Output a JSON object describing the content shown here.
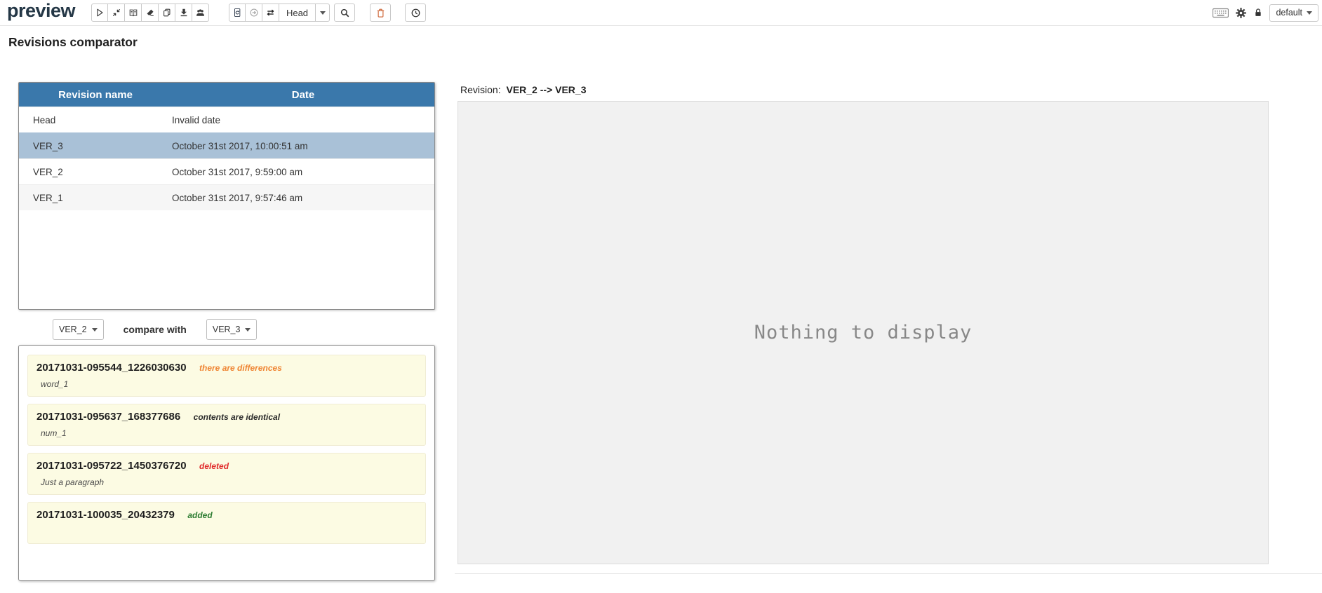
{
  "topbar": {
    "logo": "preview",
    "head_selector_label": "Head",
    "profile_label": "default",
    "icons": {
      "group1": [
        "play-icon",
        "collapse-icon",
        "book-icon",
        "eraser-icon",
        "copy-icon",
        "download-icon",
        "users-icon"
      ],
      "group2": [
        "page-refresh-icon",
        "circle-arrow-icon",
        "swap-icon"
      ],
      "single": [
        "search-icon",
        "trash-icon",
        "clock-icon"
      ],
      "right": [
        "keyboard-icon",
        "gear-icon",
        "lock-icon"
      ]
    }
  },
  "page": {
    "title": "Revisions comparator"
  },
  "revisions_table": {
    "columns": [
      "Revision name",
      "Date"
    ],
    "rows": [
      {
        "name": "Head",
        "date": "Invalid date",
        "selected": false
      },
      {
        "name": "VER_3",
        "date": "October 31st 2017, 10:00:51 am",
        "selected": true
      },
      {
        "name": "VER_2",
        "date": "October 31st 2017, 9:59:00 am",
        "selected": false
      },
      {
        "name": "VER_1",
        "date": "October 31st 2017, 9:57:46 am",
        "selected": false
      }
    ]
  },
  "compare_bar": {
    "left_value": "VER_2",
    "label": "compare with",
    "right_value": "VER_3"
  },
  "documents": [
    {
      "title": "20171031-095544_1226030630",
      "status": "there are differences",
      "subtitle": "word_1",
      "status_type": "differences"
    },
    {
      "title": "20171031-095637_168377686",
      "status": "contents are identical",
      "subtitle": "num_1",
      "status_type": "identical"
    },
    {
      "title": "20171031-095722_1450376720",
      "status": "deleted",
      "subtitle": "Just a paragraph",
      "status_type": "deleted"
    },
    {
      "title": "20171031-100035_20432379",
      "status": "added",
      "subtitle": "",
      "status_type": "added"
    }
  ],
  "diff_panel": {
    "revision_label": "Revision:",
    "revision_value": "VER_2 --> VER_3",
    "empty_message": "Nothing to display"
  },
  "colors": {
    "table_header_bg": "#3a78ab",
    "selected_row_bg": "#a9c1d7",
    "card_bg": "#fcfbe3",
    "status_differences": "#ef8432",
    "status_identical": "#2b2b2b",
    "status_deleted": "#e02b2b",
    "status_added": "#2e7d32",
    "trash_icon": "#cf6a3c"
  }
}
